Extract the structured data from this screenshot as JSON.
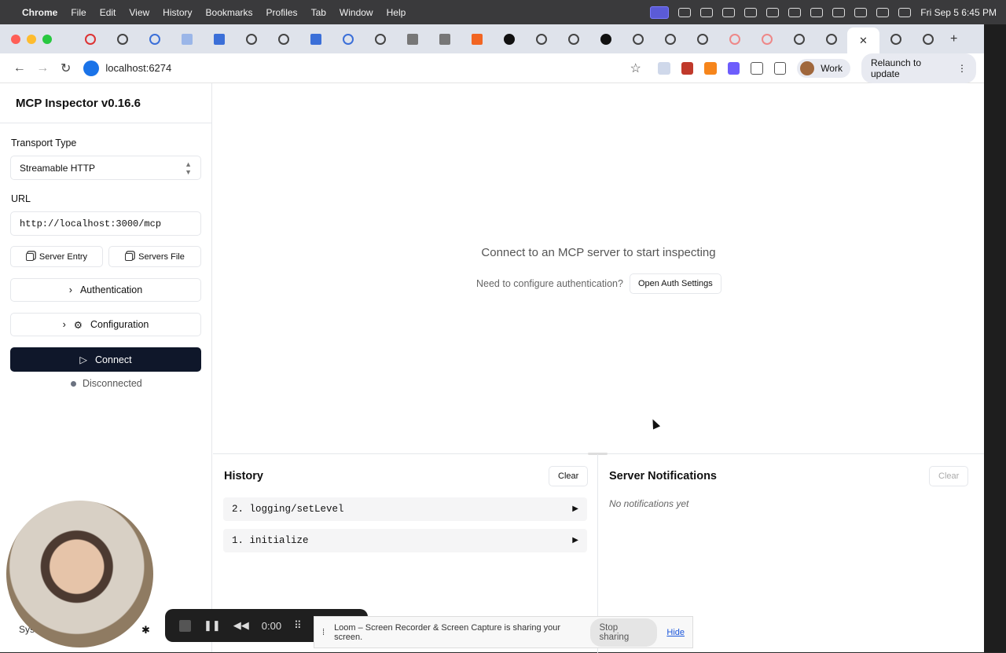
{
  "menubar": {
    "items": [
      "Chrome",
      "File",
      "Edit",
      "View",
      "History",
      "Bookmarks",
      "Profiles",
      "Tab",
      "Window",
      "Help"
    ],
    "clock": "Fri Sep 5  6:45 PM"
  },
  "browser": {
    "url": "localhost:6274",
    "profile": "Work",
    "relaunch": "Relaunch to update"
  },
  "sidebar": {
    "title": "MCP Inspector v0.16.6",
    "transport_label": "Transport Type",
    "transport_value": "Streamable HTTP",
    "url_label": "URL",
    "url_value": "http://localhost:3000/mcp",
    "server_entry": "Server Entry",
    "servers_file": "Servers File",
    "authentication": "Authentication",
    "configuration": "Configuration",
    "connect": "Connect",
    "status": "Disconnected",
    "theme_truncated": "Sys"
  },
  "main": {
    "empty_message": "Connect to an MCP server to start inspecting",
    "auth_prompt": "Need to configure authentication?",
    "auth_button": "Open Auth Settings"
  },
  "history": {
    "title": "History",
    "clear": "Clear",
    "items": [
      "2.  logging/setLevel",
      "1.  initialize"
    ]
  },
  "notifications": {
    "title": "Server Notifications",
    "clear": "Clear",
    "empty": "No notifications yet"
  },
  "loom": {
    "timer": "0:00",
    "message": "Loom – Screen Recorder & Screen Capture is sharing your screen.",
    "stop": "Stop sharing",
    "hide": "Hide"
  }
}
